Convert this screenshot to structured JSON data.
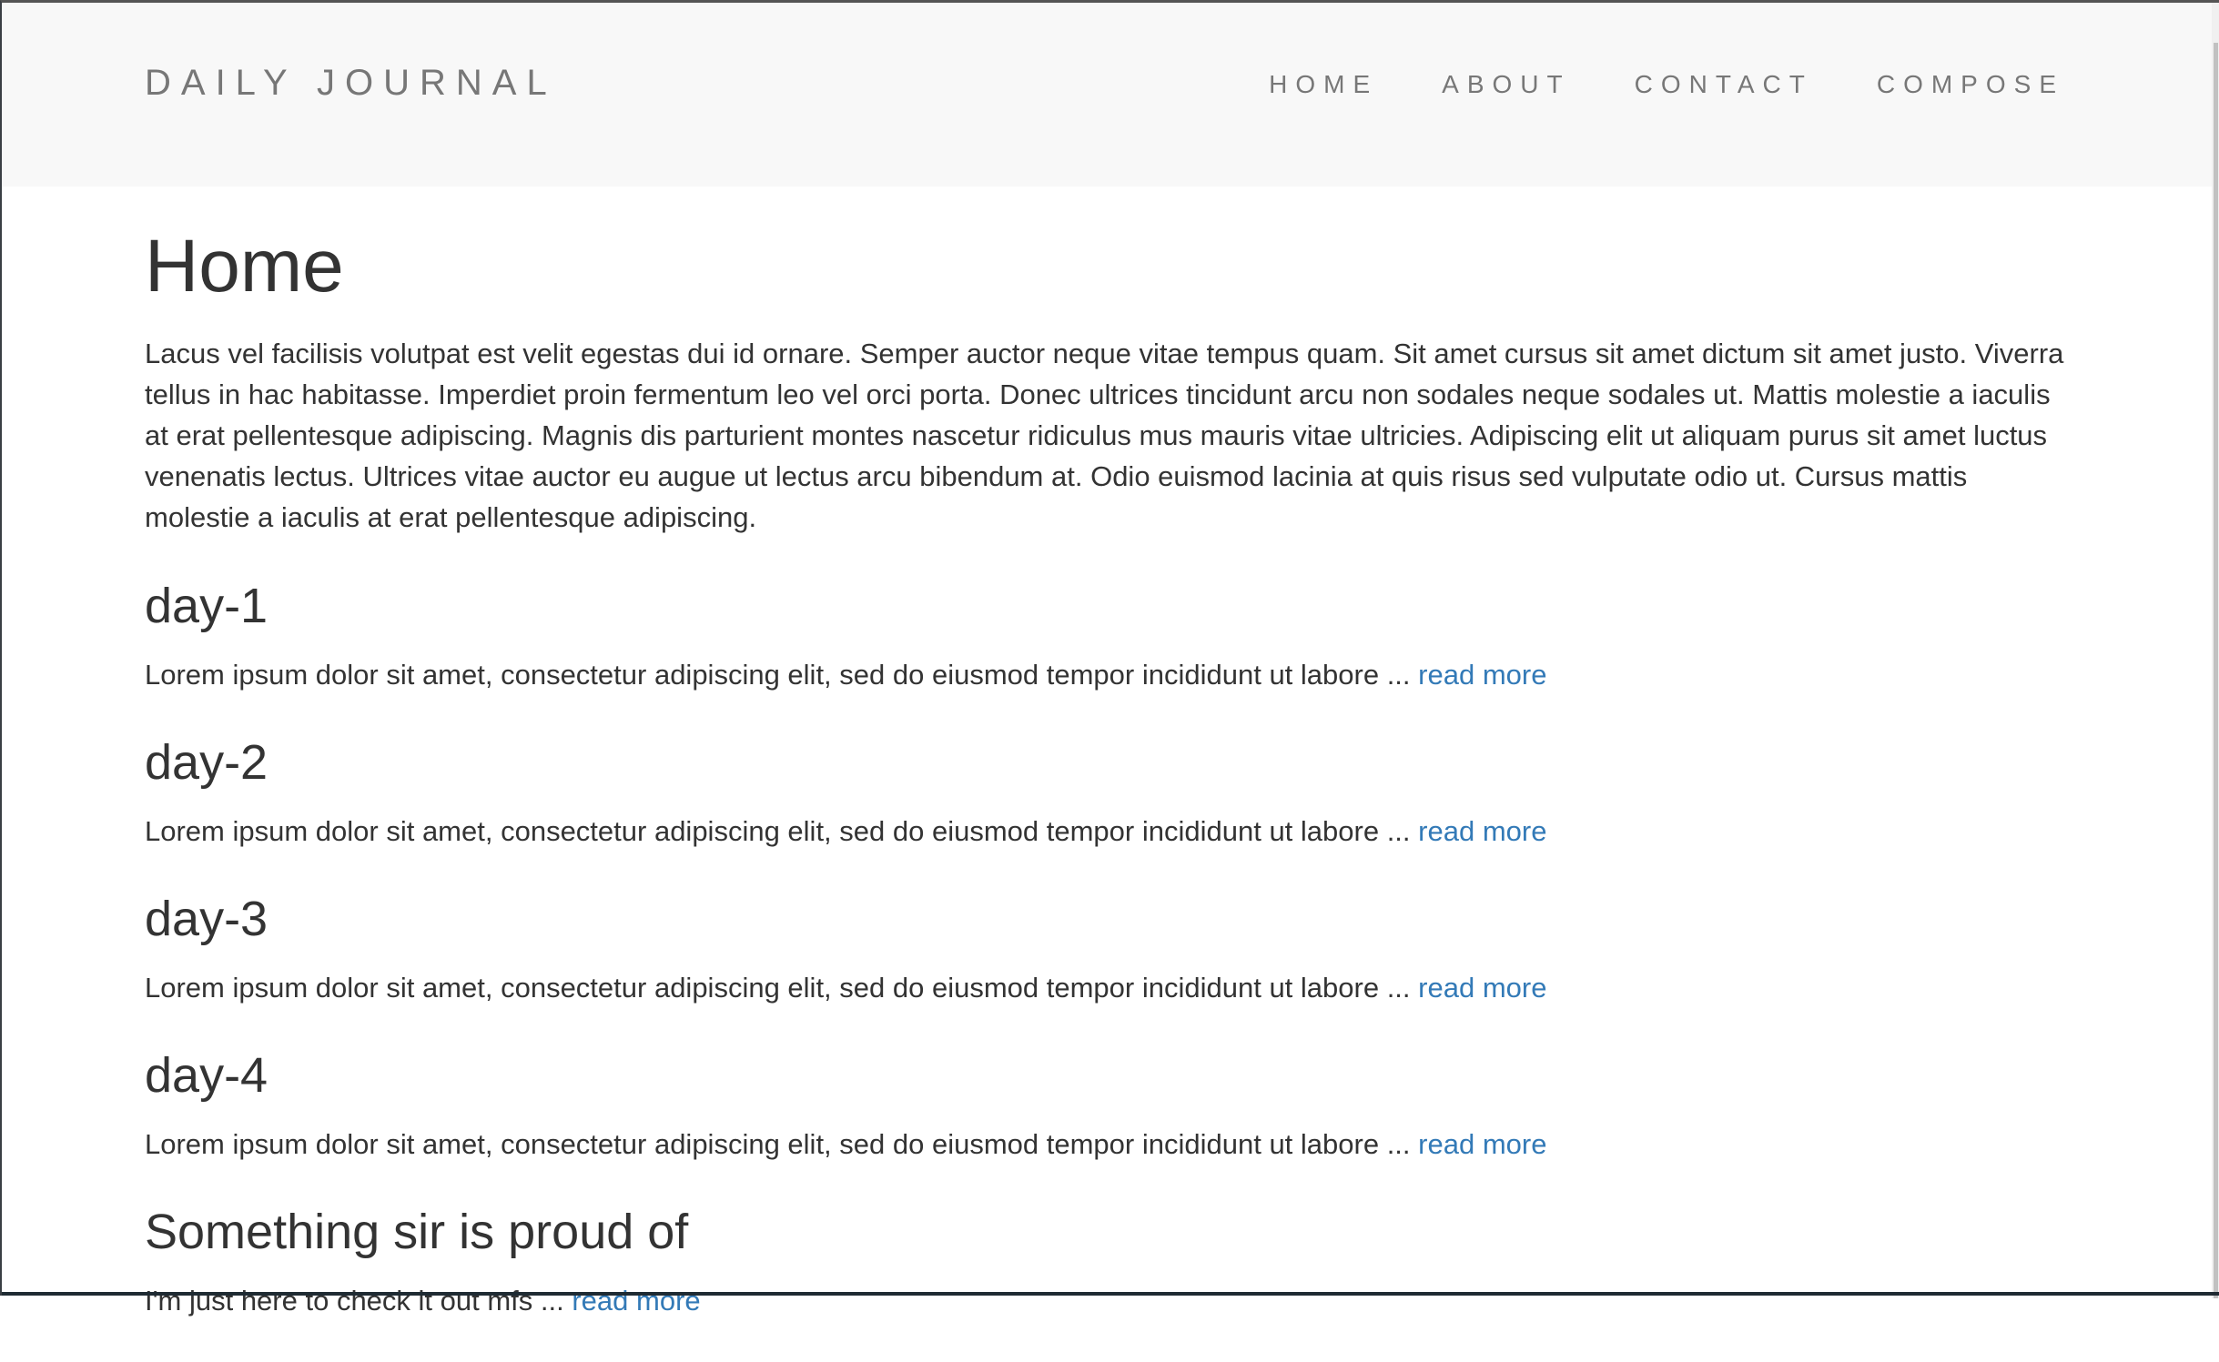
{
  "navbar": {
    "brand": "DAILY JOURNAL",
    "links": [
      "HOME",
      "ABOUT",
      "CONTACT",
      "COMPOSE"
    ]
  },
  "main": {
    "title": "Home",
    "intro": "Lacus vel facilisis volutpat est velit egestas dui id ornare. Semper auctor neque vitae tempus quam. Sit amet cursus sit amet dictum sit amet justo. Viverra tellus in hac habitasse. Imperdiet proin fermentum leo vel orci porta. Donec ultrices tincidunt arcu non sodales neque sodales ut. Mattis molestie a iaculis at erat pellentesque adipiscing. Magnis dis parturient montes nascetur ridiculus mus mauris vitae ultricies. Adipiscing elit ut aliquam purus sit amet luctus venenatis lectus. Ultrices vitae auctor eu augue ut lectus arcu bibendum at. Odio euismod lacinia at quis risus sed vulputate odio ut. Cursus mattis molestie a iaculis at erat pellentesque adipiscing.",
    "posts": [
      {
        "title": "day-1",
        "excerpt": "Lorem ipsum dolor sit amet, consectetur adipiscing elit, sed do eiusmod tempor incididunt ut labore ... ",
        "link": "read more"
      },
      {
        "title": "day-2",
        "excerpt": "Lorem ipsum dolor sit amet, consectetur adipiscing elit, sed do eiusmod tempor incididunt ut labore ... ",
        "link": "read more"
      },
      {
        "title": "day-3",
        "excerpt": "Lorem ipsum dolor sit amet, consectetur adipiscing elit, sed do eiusmod tempor incididunt ut labore ... ",
        "link": "read more"
      },
      {
        "title": "day-4",
        "excerpt": "Lorem ipsum dolor sit amet, consectetur adipiscing elit, sed do eiusmod tempor incididunt ut labore ... ",
        "link": "read more"
      },
      {
        "title": "Something sir is proud of",
        "excerpt": "I'm just here to check it out mfs ... ",
        "link": "read more"
      }
    ]
  },
  "colors": {
    "link": "#337ab7",
    "text": "#333333",
    "navbar": "#f8f8f8"
  }
}
